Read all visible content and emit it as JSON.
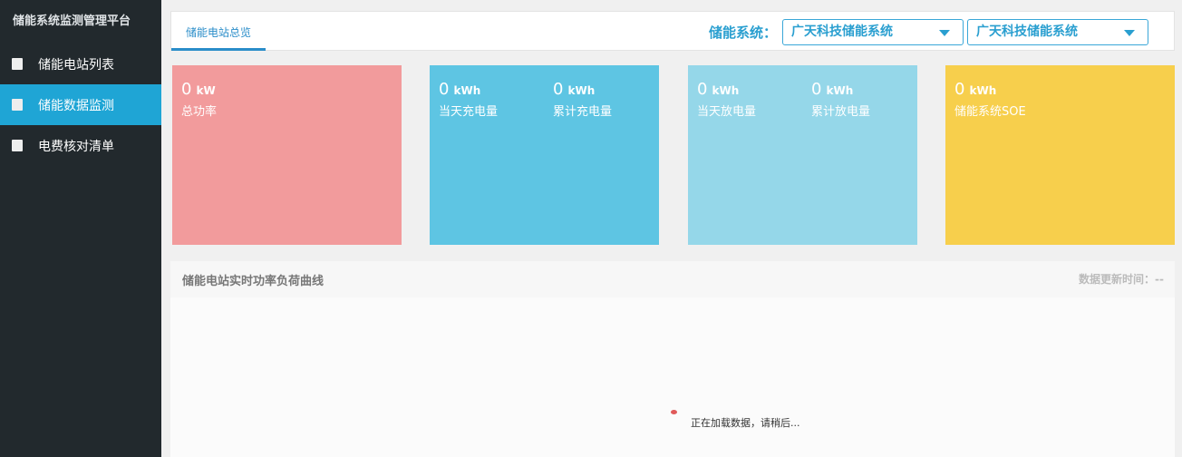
{
  "sidebar": {
    "title": "储能系统监测管理平台",
    "items": [
      {
        "label": "储能电站列表",
        "icon": "document-icon"
      },
      {
        "label": "储能数据监测",
        "icon": "monitor-icon",
        "active": true
      },
      {
        "label": "电费核对清单",
        "icon": "copy-icon"
      }
    ]
  },
  "topbar": {
    "tab": "储能电站总览",
    "system_label": "储能系统：",
    "select1": "广天科技储能系统",
    "select2": "广天科技储能系统"
  },
  "cards": [
    {
      "color": "#f29b9c",
      "metrics": [
        {
          "value": "0",
          "unit": "kW",
          "label": "总功率"
        }
      ]
    },
    {
      "color": "#5ec5e3",
      "metrics": [
        {
          "value": "0",
          "unit": "kWh",
          "label": "当天充电量"
        },
        {
          "value": "0",
          "unit": "kWh",
          "label": "累计充电量"
        }
      ]
    },
    {
      "color": "#95d7e9",
      "metrics": [
        {
          "value": "0",
          "unit": "kWh",
          "label": "当天放电量"
        },
        {
          "value": "0",
          "unit": "kWh",
          "label": "累计放电量"
        }
      ]
    },
    {
      "color": "#f7cf4c",
      "metrics": [
        {
          "value": "0",
          "unit": "kWh",
          "label": "储能系统SOE"
        }
      ]
    }
  ],
  "chart": {
    "title": "储能电站实时功率负荷曲线",
    "update_time": "数据更新时间：--",
    "loading": "正在加载数据，请稍后..."
  }
}
